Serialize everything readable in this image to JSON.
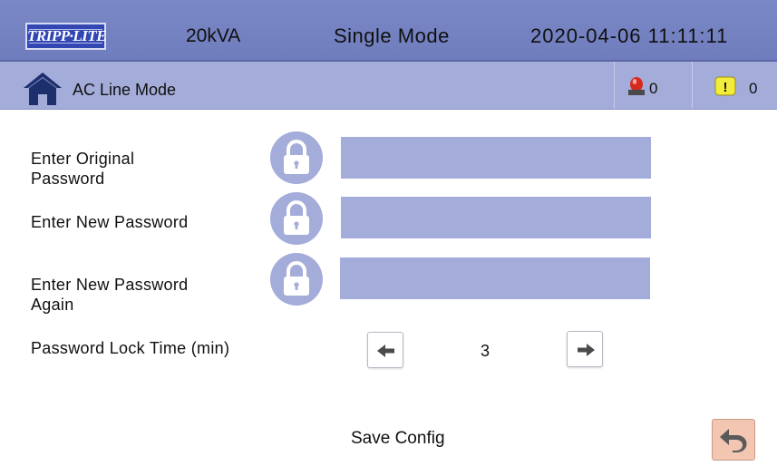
{
  "header": {
    "logo_text": "TRIPP·LITE",
    "power_rating": "20kVA",
    "mode": "Single Mode",
    "datetime": "2020-04-06 11:11:11"
  },
  "status_bar": {
    "title": "AC Line Mode",
    "alarm_count": "0",
    "warning_count": "0",
    "warning_symbol": "!",
    "icons": [
      "home-icon",
      "alarm-light-icon",
      "warning-icon"
    ]
  },
  "form": {
    "original_password_label": "Enter Original\nPassword",
    "new_password_label": "Enter New Password",
    "confirm_password_label": "Enter New Password\nAgain",
    "original_password_value": "",
    "new_password_value": "",
    "confirm_password_value": "",
    "lock_time_label": "Password Lock Time (min)",
    "lock_time_value": "3",
    "save_label": "Save Config"
  },
  "colors": {
    "header_bg": "#7b88c6",
    "status_bg": "#a4acd9",
    "field_bg": "#a4acd9",
    "lock_circle": "#a4acd9",
    "back_button_bg": "#f2c6b1"
  }
}
